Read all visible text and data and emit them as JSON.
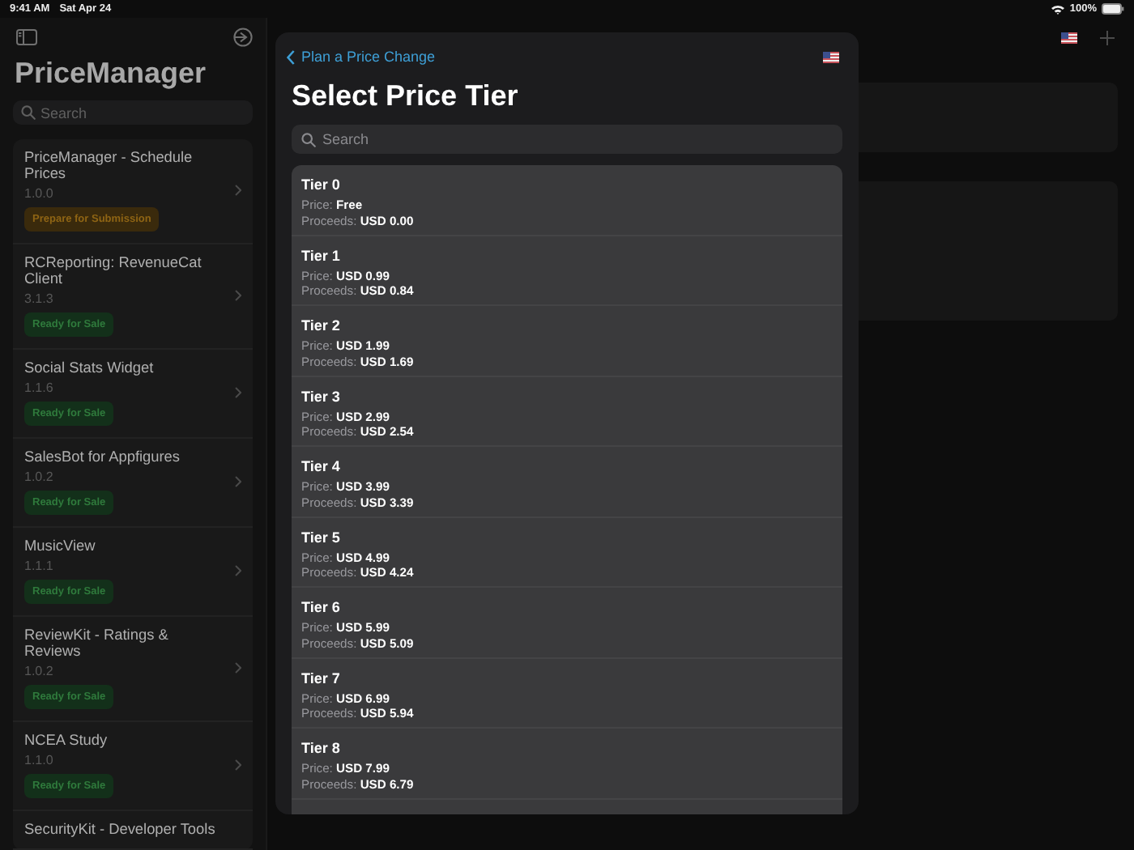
{
  "status_bar": {
    "time": "9:41 AM",
    "date": "Sat Apr 24",
    "battery": "100%"
  },
  "sidebar": {
    "title": "PriceManager",
    "search": {
      "placeholder": "Search"
    },
    "apps": [
      {
        "name": "PriceManager - Schedule Prices",
        "version": "1.0.0",
        "status": "Prepare for Submission",
        "kind": "prepare"
      },
      {
        "name": "RCReporting: RevenueCat Client",
        "version": "3.1.3",
        "status": "Ready for Sale",
        "kind": "ready"
      },
      {
        "name": "Social Stats Widget",
        "version": "1.1.6",
        "status": "Ready for Sale",
        "kind": "ready"
      },
      {
        "name": "SalesBot for Appfigures",
        "version": "1.0.2",
        "status": "Ready for Sale",
        "kind": "ready"
      },
      {
        "name": "MusicView",
        "version": "1.1.1",
        "status": "Ready for Sale",
        "kind": "ready"
      },
      {
        "name": "ReviewKit - Ratings & Reviews",
        "version": "1.0.2",
        "status": "Ready for Sale",
        "kind": "ready"
      },
      {
        "name": "NCEA Study",
        "version": "1.1.0",
        "status": "Ready for Sale",
        "kind": "ready"
      },
      {
        "name": "SecurityKit - Developer Tools"
      }
    ]
  },
  "sheet": {
    "back_label": "Plan a Price Change",
    "title": "Select Price Tier",
    "search": {
      "placeholder": "Search"
    },
    "tiers": [
      {
        "name": "Tier 0",
        "price_label": "Price:",
        "price": "Free",
        "proceeds_label": "Proceeds:",
        "proceeds": "USD 0.00"
      },
      {
        "name": "Tier 1",
        "price_label": "Price:",
        "price": "USD 0.99",
        "proceeds_label": "Proceeds:",
        "proceeds": "USD 0.84"
      },
      {
        "name": "Tier 2",
        "price_label": "Price:",
        "price": "USD 1.99",
        "proceeds_label": "Proceeds:",
        "proceeds": "USD 1.69"
      },
      {
        "name": "Tier 3",
        "price_label": "Price:",
        "price": "USD 2.99",
        "proceeds_label": "Proceeds:",
        "proceeds": "USD 2.54"
      },
      {
        "name": "Tier 4",
        "price_label": "Price:",
        "price": "USD 3.99",
        "proceeds_label": "Proceeds:",
        "proceeds": "USD 3.39"
      },
      {
        "name": "Tier 5",
        "price_label": "Price:",
        "price": "USD 4.99",
        "proceeds_label": "Proceeds:",
        "proceeds": "USD 4.24"
      },
      {
        "name": "Tier 6",
        "price_label": "Price:",
        "price": "USD 5.99",
        "proceeds_label": "Proceeds:",
        "proceeds": "USD 5.09"
      },
      {
        "name": "Tier 7",
        "price_label": "Price:",
        "price": "USD 6.99",
        "proceeds_label": "Proceeds:",
        "proceeds": "USD 5.94"
      },
      {
        "name": "Tier 8",
        "price_label": "Price:",
        "price": "USD 7.99",
        "proceeds_label": "Proceeds:",
        "proceeds": "USD 6.79"
      }
    ]
  }
}
